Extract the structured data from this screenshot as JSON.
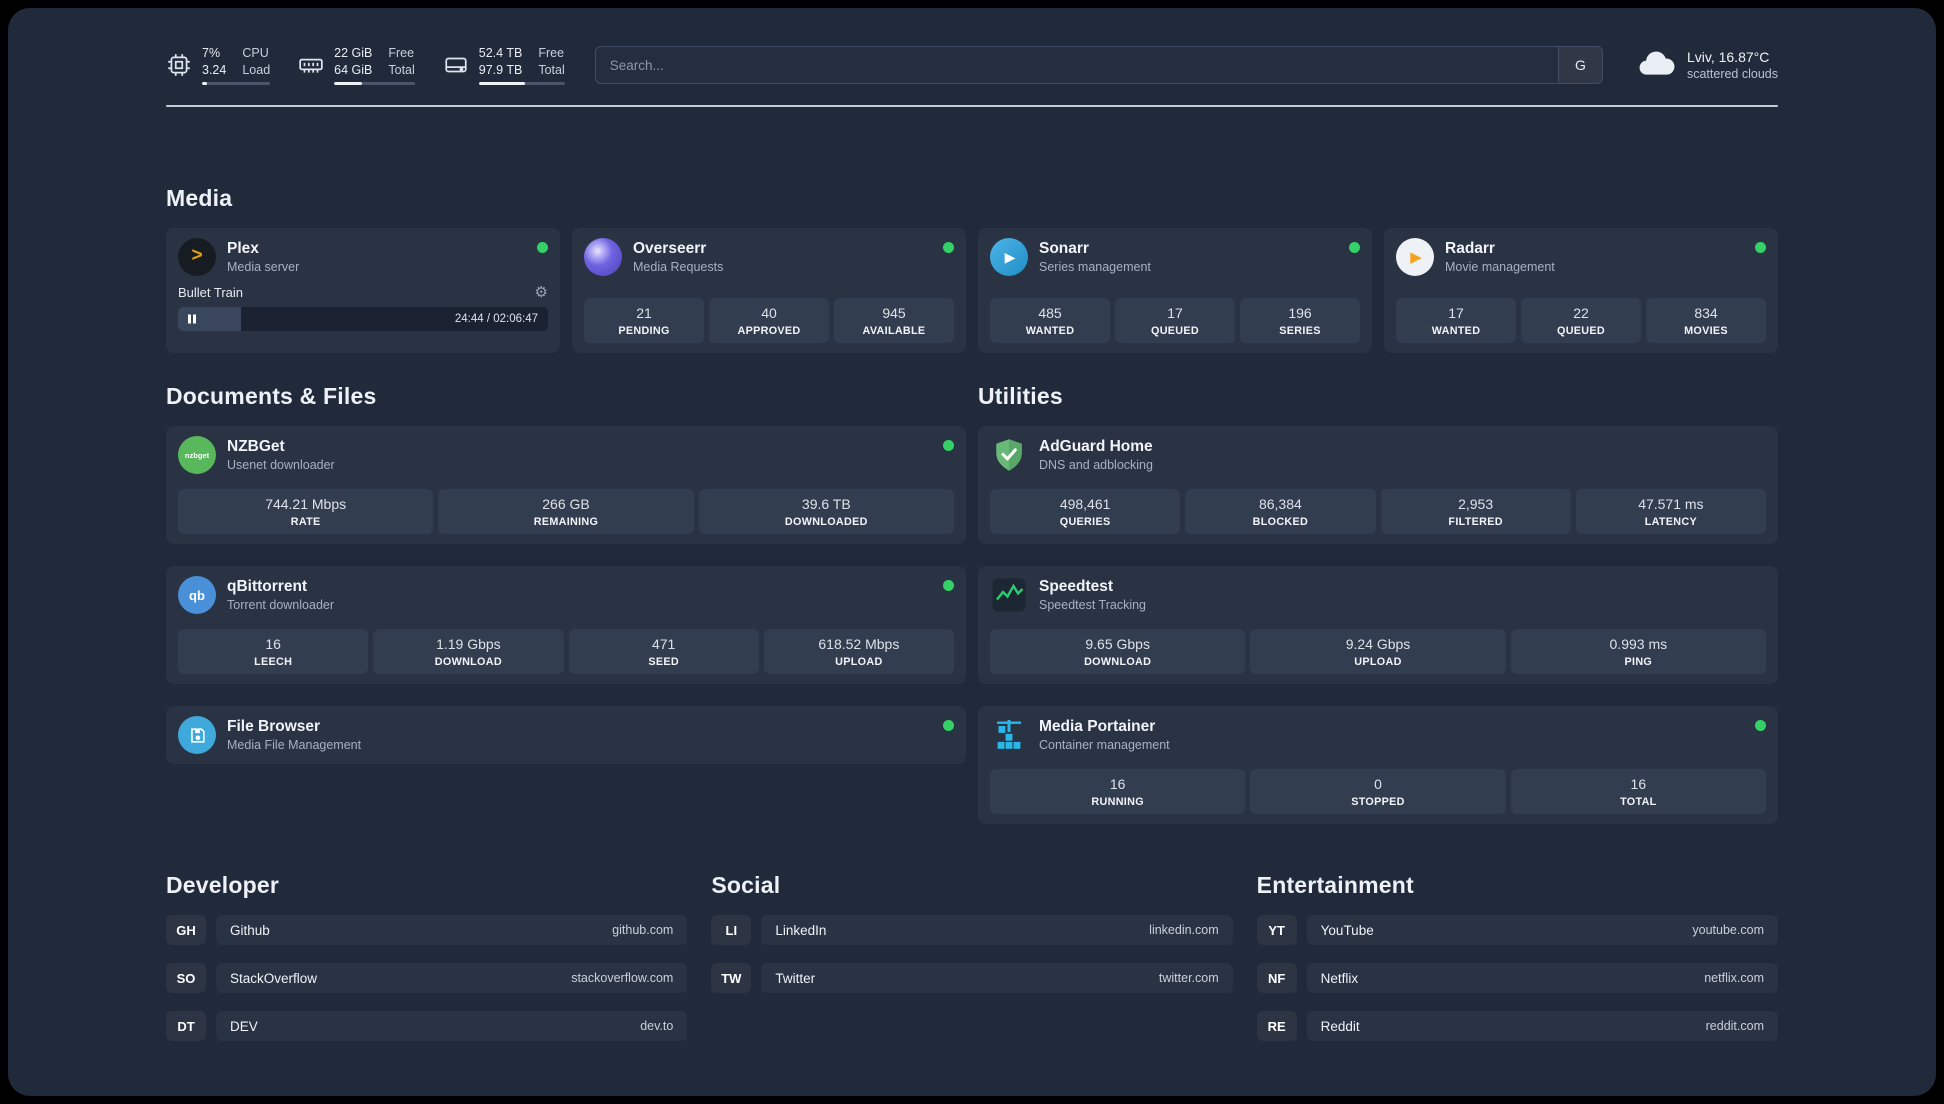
{
  "colors": {
    "page_background": "#212a3b",
    "card_background": "#2a3343",
    "tile_background": "#333d50",
    "status_online": "#36d069",
    "plex_amber": "#e5a00d",
    "sonarr_blue": "#35a7dd",
    "radarr_orange": "#f6a21c",
    "nzbget_green": "#59b75c",
    "qbittorrent_blue": "#4a90d9",
    "adguard_green": "#68b978",
    "speedtest_green": "#2ecc71",
    "portainer_blue": "#29b6e8",
    "filebrowser_blue": "#3fa9dc"
  },
  "header": {
    "cpu": {
      "value_top": "7%",
      "value_bottom": "3.24",
      "label_top": "CPU",
      "label_bottom": "Load",
      "bar_style": "width:7%"
    },
    "ram": {
      "value_top": "22 GiB",
      "value_bottom": "64 GiB",
      "label_top": "Free",
      "label_bottom": "Total",
      "bar_style": "width:34%"
    },
    "disk": {
      "value_top": "52.4 TB",
      "value_bottom": "97.9 TB",
      "label_top": "Free",
      "label_bottom": "Total",
      "bar_style": "width:54%"
    },
    "search": {
      "placeholder": "Search...",
      "button_label": "G"
    },
    "weather": {
      "location": "Lviv, 16.87°C",
      "condition": "scattered clouds"
    }
  },
  "media": {
    "title": "Media",
    "plex": {
      "name": "Plex",
      "subtitle": "Media server",
      "now_playing": "Bullet Train",
      "time": "24:44 / 02:06:47",
      "progress_style": "width:17%"
    },
    "overseerr": {
      "name": "Overseerr",
      "subtitle": "Media Requests",
      "stats": [
        {
          "value": "21",
          "label": "PENDING"
        },
        {
          "value": "40",
          "label": "APPROVED"
        },
        {
          "value": "945",
          "label": "AVAILABLE"
        }
      ]
    },
    "sonarr": {
      "name": "Sonarr",
      "subtitle": "Series management",
      "stats": [
        {
          "value": "485",
          "label": "WANTED"
        },
        {
          "value": "17",
          "label": "QUEUED"
        },
        {
          "value": "196",
          "label": "SERIES"
        }
      ]
    },
    "radarr": {
      "name": "Radarr",
      "subtitle": "Movie management",
      "stats": [
        {
          "value": "17",
          "label": "WANTED"
        },
        {
          "value": "22",
          "label": "QUEUED"
        },
        {
          "value": "834",
          "label": "MOVIES"
        }
      ]
    }
  },
  "documents": {
    "title": "Documents & Files",
    "nzbget": {
      "name": "NZBGet",
      "subtitle": "Usenet downloader",
      "stats": [
        {
          "value": "744.21 Mbps",
          "label": "RATE"
        },
        {
          "value": "266 GB",
          "label": "REMAINING"
        },
        {
          "value": "39.6 TB",
          "label": "DOWNLOADED"
        }
      ]
    },
    "qbittorrent": {
      "name": "qBittorrent",
      "subtitle": "Torrent downloader",
      "stats": [
        {
          "value": "16",
          "label": "LEECH"
        },
        {
          "value": "1.19 Gbps",
          "label": "DOWNLOAD"
        },
        {
          "value": "471",
          "label": "SEED"
        },
        {
          "value": "618.52 Mbps",
          "label": "UPLOAD"
        }
      ]
    },
    "filebrowser": {
      "name": "File Browser",
      "subtitle": "Media File Management"
    }
  },
  "utilities": {
    "title": "Utilities",
    "adguard": {
      "name": "AdGuard Home",
      "subtitle": "DNS and adblocking",
      "stats": [
        {
          "value": "498,461",
          "label": "QUERIES"
        },
        {
          "value": "86,384",
          "label": "BLOCKED"
        },
        {
          "value": "2,953",
          "label": "FILTERED"
        },
        {
          "value": "47.571 ms",
          "label": "LATENCY"
        }
      ]
    },
    "speedtest": {
      "name": "Speedtest",
      "subtitle": "Speedtest Tracking",
      "stats": [
        {
          "value": "9.65 Gbps",
          "label": "DOWNLOAD"
        },
        {
          "value": "9.24 Gbps",
          "label": "UPLOAD"
        },
        {
          "value": "0.993 ms",
          "label": "PING"
        }
      ]
    },
    "portainer": {
      "name": "Media Portainer",
      "subtitle": "Container management",
      "stats": [
        {
          "value": "16",
          "label": "RUNNING"
        },
        {
          "value": "0",
          "label": "STOPPED"
        },
        {
          "value": "16",
          "label": "TOTAL"
        }
      ]
    }
  },
  "bookmarks": {
    "developer": {
      "title": "Developer",
      "links": [
        {
          "abbr": "GH",
          "name": "Github",
          "url": "github.com"
        },
        {
          "abbr": "SO",
          "name": "StackOverflow",
          "url": "stackoverflow.com"
        },
        {
          "abbr": "DT",
          "name": "DEV",
          "url": "dev.to"
        }
      ]
    },
    "social": {
      "title": "Social",
      "links": [
        {
          "abbr": "LI",
          "name": "LinkedIn",
          "url": "linkedin.com"
        },
        {
          "abbr": "TW",
          "name": "Twitter",
          "url": "twitter.com"
        }
      ]
    },
    "entertainment": {
      "title": "Entertainment",
      "links": [
        {
          "abbr": "YT",
          "name": "YouTube",
          "url": "youtube.com"
        },
        {
          "abbr": "NF",
          "name": "Netflix",
          "url": "netflix.com"
        },
        {
          "abbr": "RE",
          "name": "Reddit",
          "url": "reddit.com"
        }
      ]
    }
  }
}
